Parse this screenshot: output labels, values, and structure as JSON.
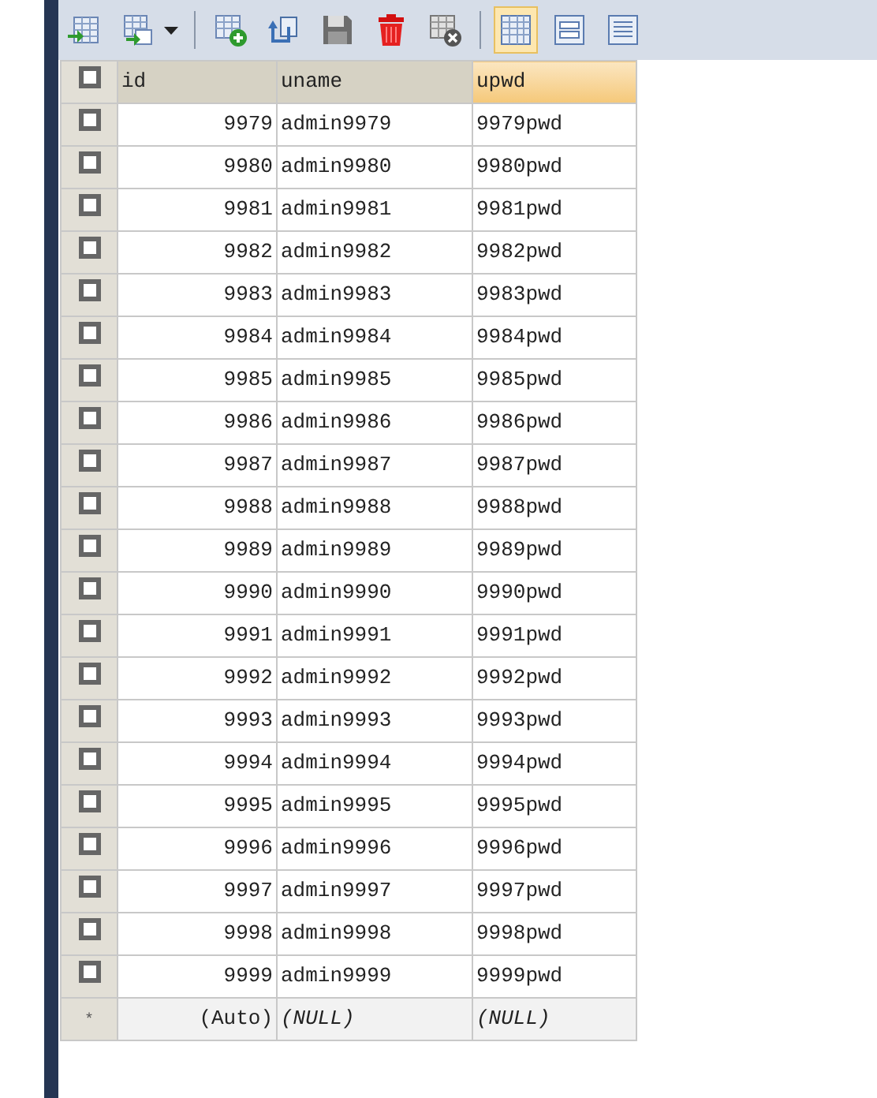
{
  "toolbar": [
    {
      "kind": "import"
    },
    {
      "kind": "export"
    },
    {
      "kind": "dropdown"
    },
    {
      "kind": "sep"
    },
    {
      "kind": "add"
    },
    {
      "kind": "undo"
    },
    {
      "kind": "save"
    },
    {
      "kind": "delete"
    },
    {
      "kind": "cancel"
    },
    {
      "kind": "sep"
    },
    {
      "kind": "grid",
      "selected": true
    },
    {
      "kind": "form",
      "selected": false
    },
    {
      "kind": "text",
      "selected": false
    }
  ],
  "table": {
    "columns": [
      {
        "label": "id",
        "selected": false
      },
      {
        "label": "uname",
        "selected": false
      },
      {
        "label": "upwd",
        "selected": true
      }
    ],
    "header_checked": false,
    "rows": [
      {
        "checked": false,
        "cells": [
          "9979",
          "admin9979",
          "9979pwd"
        ]
      },
      {
        "checked": false,
        "cells": [
          "9980",
          "admin9980",
          "9980pwd"
        ]
      },
      {
        "checked": false,
        "cells": [
          "9981",
          "admin9981",
          "9981pwd"
        ]
      },
      {
        "checked": false,
        "cells": [
          "9982",
          "admin9982",
          "9982pwd"
        ]
      },
      {
        "checked": false,
        "cells": [
          "9983",
          "admin9983",
          "9983pwd"
        ]
      },
      {
        "checked": false,
        "cells": [
          "9984",
          "admin9984",
          "9984pwd"
        ]
      },
      {
        "checked": false,
        "cells": [
          "9985",
          "admin9985",
          "9985pwd"
        ]
      },
      {
        "checked": false,
        "cells": [
          "9986",
          "admin9986",
          "9986pwd"
        ]
      },
      {
        "checked": false,
        "cells": [
          "9987",
          "admin9987",
          "9987pwd"
        ]
      },
      {
        "checked": false,
        "cells": [
          "9988",
          "admin9988",
          "9988pwd"
        ]
      },
      {
        "checked": false,
        "cells": [
          "9989",
          "admin9989",
          "9989pwd"
        ]
      },
      {
        "checked": false,
        "cells": [
          "9990",
          "admin9990",
          "9990pwd"
        ]
      },
      {
        "checked": false,
        "cells": [
          "9991",
          "admin9991",
          "9991pwd"
        ]
      },
      {
        "checked": false,
        "cells": [
          "9992",
          "admin9992",
          "9992pwd"
        ]
      },
      {
        "checked": false,
        "cells": [
          "9993",
          "admin9993",
          "9993pwd"
        ]
      },
      {
        "checked": false,
        "cells": [
          "9994",
          "admin9994",
          "9994pwd"
        ]
      },
      {
        "checked": false,
        "cells": [
          "9995",
          "admin9995",
          "9995pwd"
        ]
      },
      {
        "checked": false,
        "cells": [
          "9996",
          "admin9996",
          "9996pwd"
        ]
      },
      {
        "checked": false,
        "cells": [
          "9997",
          "admin9997",
          "9997pwd"
        ]
      },
      {
        "checked": false,
        "cells": [
          "9998",
          "admin9998",
          "9998pwd"
        ]
      },
      {
        "checked": false,
        "cells": [
          "9999",
          "admin9999",
          "9999pwd"
        ]
      }
    ],
    "new_row": {
      "marker": "*",
      "cells": [
        "(Auto)",
        "(NULL)",
        "(NULL)"
      ]
    }
  }
}
